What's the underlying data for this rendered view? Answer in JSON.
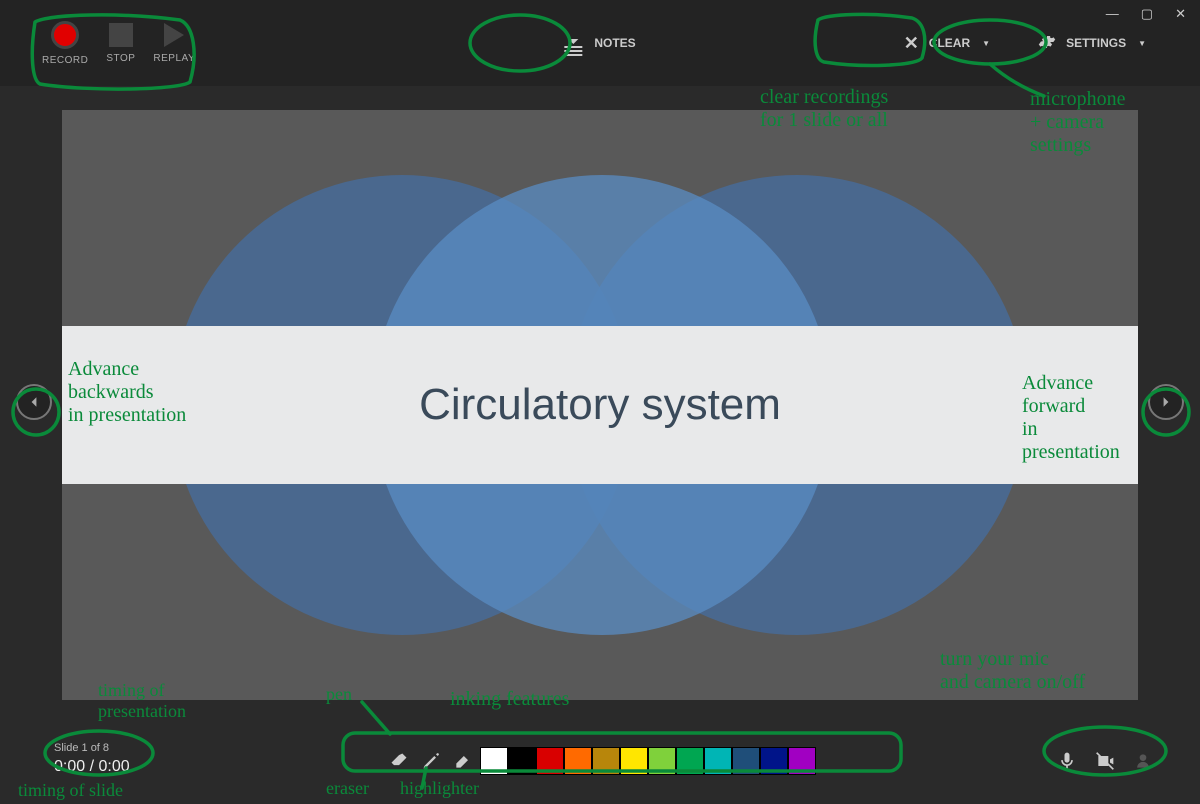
{
  "window": {
    "minimize": "—",
    "maximize": "▢",
    "close": "✕"
  },
  "toolbar": {
    "record": "RECORD",
    "stop": "STOP",
    "replay": "REPLAY",
    "notes": "NOTES",
    "clear": "CLEAR",
    "settings": "SETTINGS"
  },
  "slide": {
    "title": "Circulatory system"
  },
  "status": {
    "slide_label": "Slide 1 of 8",
    "time": "0:00 / 0:00"
  },
  "ink": {
    "colors": [
      "#ffffff",
      "#000000",
      "#d90000",
      "#ff6a00",
      "#b8860b",
      "#ffe600",
      "#7fd13b",
      "#00a651",
      "#00b5b5",
      "#1f4e79",
      "#001489",
      "#a100c2"
    ]
  },
  "annotations": {
    "rec": "",
    "clear": "clear recordings\nfor 1 slide or all",
    "settings": "microphone\n+ camera\nsettings",
    "back": "Advance\nbackwards\nin presentation",
    "fwd": "Advance\nforward\nin\npresentation",
    "timing1": "timing of\npresentation",
    "timing2": "timing of slide",
    "pen": "pen",
    "eraser": "eraser",
    "hl": "highlighter",
    "ink": "inking features",
    "mic": "turn your mic\nand camera on/off"
  }
}
